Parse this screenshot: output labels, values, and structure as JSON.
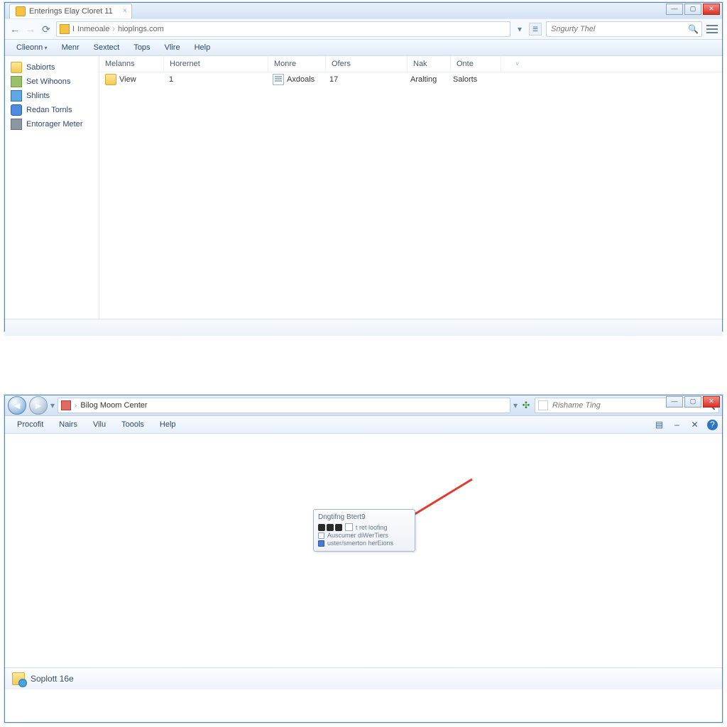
{
  "win1": {
    "tab_title": "Enterings Elay Cloret 11",
    "addr_prefix": "I",
    "addr_host": "Inmeoale",
    "addr_path": "hioplngs.com",
    "search_placeholder": "Sngurty Thel",
    "menubar": [
      "Clieonn",
      "Menr",
      "Sextect",
      "Tops",
      "Vlire",
      "Help"
    ],
    "sidebar": [
      {
        "icon": "ic-folder",
        "label": "Sabiorts"
      },
      {
        "icon": "ic-a",
        "label": "Set Wihoons"
      },
      {
        "icon": "ic-b",
        "label": "Shlints"
      },
      {
        "icon": "ic-c",
        "label": "Redan Tornls"
      },
      {
        "icon": "ic-d",
        "label": "Entorager Meter"
      }
    ],
    "columns": {
      "c1": "Melanns",
      "c2": "Horernet",
      "c3": "Monre",
      "c4": "Ofers",
      "c5": "Nak",
      "c6": "Onte"
    },
    "row": {
      "c1": "View",
      "c2": "1",
      "c3": "Axdoals",
      "c4": "17",
      "c5": "Aralting",
      "c6": "Salorts"
    }
  },
  "win2": {
    "addr_title": "Bilog Moom Center",
    "search_placeholder": "Rishame Ting",
    "menubar": [
      "Procofit",
      "Nairs",
      "Vilu",
      "Toools",
      "Help"
    ],
    "popup": {
      "title": "Dngtifng Btert9",
      "row1": "t ret loofing",
      "row2": "Auscumer diWerTiers",
      "row3": "uster/smerton herEions"
    },
    "status": "Soplott 16e"
  }
}
